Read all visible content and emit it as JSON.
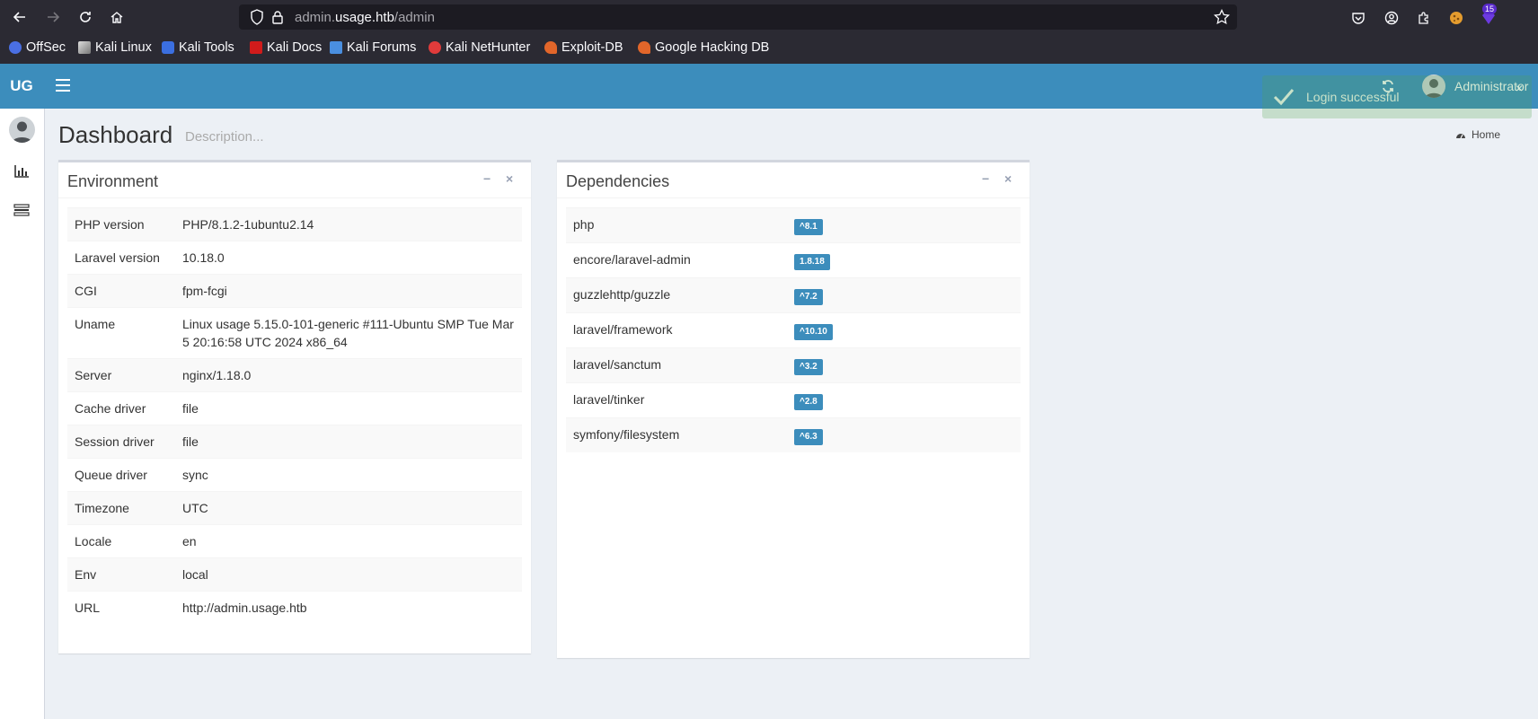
{
  "browser": {
    "url_prefix": "admin.",
    "url_domain": "usage.htb",
    "url_path": "/admin",
    "extension_badge": "15",
    "bookmarks": [
      {
        "label": "OffSec",
        "icon": "offsec-icon",
        "color": "#4a6fe3"
      },
      {
        "label": "Kali Linux",
        "icon": "kali-icon",
        "color": "#e6e6e6"
      },
      {
        "label": "Kali Tools",
        "icon": "kali-tools-icon",
        "color": "#3b6fe0"
      },
      {
        "label": "Kali Docs",
        "icon": "kali-docs-icon",
        "color": "#d11b1b"
      },
      {
        "label": "Kali Forums",
        "icon": "kali-forums-icon",
        "color": "#4a8fe0"
      },
      {
        "label": "Kali NetHunter",
        "icon": "nethunter-icon",
        "color": "#e03b3b"
      },
      {
        "label": "Exploit-DB",
        "icon": "exploitdb-icon",
        "color": "#e2662a"
      },
      {
        "label": "Google Hacking DB",
        "icon": "ghdb-icon",
        "color": "#e2662a"
      }
    ]
  },
  "header": {
    "logo": "UG",
    "user_name": "Administrator",
    "brand_color": "#3c8dbc"
  },
  "toast": {
    "message": "Login successful",
    "close": "×"
  },
  "page": {
    "title": "Dashboard",
    "description": "Description...",
    "breadcrumb_home": "Home"
  },
  "environment": {
    "title": "Environment",
    "rows": [
      {
        "key": "PHP version",
        "value": "PHP/8.1.2-1ubuntu2.14"
      },
      {
        "key": "Laravel version",
        "value": "10.18.0"
      },
      {
        "key": "CGI",
        "value": "fpm-fcgi"
      },
      {
        "key": "Uname",
        "value": "Linux usage 5.15.0-101-generic #111-Ubuntu SMP Tue Mar 5 20:16:58 UTC 2024 x86_64"
      },
      {
        "key": "Server",
        "value": "nginx/1.18.0"
      },
      {
        "key": "Cache driver",
        "value": "file"
      },
      {
        "key": "Session driver",
        "value": "file"
      },
      {
        "key": "Queue driver",
        "value": "sync"
      },
      {
        "key": "Timezone",
        "value": "UTC"
      },
      {
        "key": "Locale",
        "value": "en"
      },
      {
        "key": "Env",
        "value": "local"
      },
      {
        "key": "URL",
        "value": "http://admin.usage.htb"
      }
    ]
  },
  "dependencies": {
    "title": "Dependencies",
    "rows": [
      {
        "name": "php",
        "version": "^8.1"
      },
      {
        "name": "encore/laravel-admin",
        "version": "1.8.18"
      },
      {
        "name": "guzzlehttp/guzzle",
        "version": "^7.2"
      },
      {
        "name": "laravel/framework",
        "version": "^10.10"
      },
      {
        "name": "laravel/sanctum",
        "version": "^3.2"
      },
      {
        "name": "laravel/tinker",
        "version": "^2.8"
      },
      {
        "name": "symfony/filesystem",
        "version": "^6.3"
      }
    ]
  },
  "box_tools": {
    "collapse": "−",
    "remove": "×"
  }
}
